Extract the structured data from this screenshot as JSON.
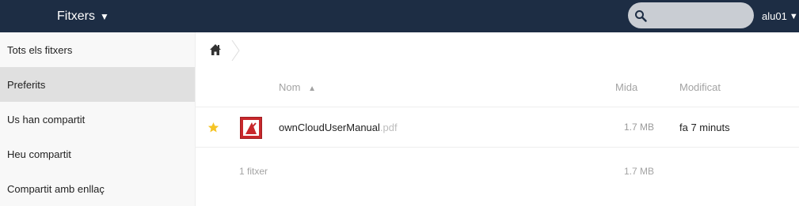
{
  "header": {
    "app_name": "Fitxers",
    "search": {
      "value": "",
      "placeholder": ""
    },
    "user": "alu01"
  },
  "sidebar": {
    "items": [
      {
        "label": "Tots els fitxers",
        "active": false
      },
      {
        "label": "Preferits",
        "active": true
      },
      {
        "label": "Us han compartit",
        "active": false
      },
      {
        "label": "Heu compartit",
        "active": false
      },
      {
        "label": "Compartit amb enllaç",
        "active": false
      }
    ]
  },
  "table": {
    "columns": {
      "name": "Nom",
      "size": "Mida",
      "modified": "Modificat"
    },
    "sort_indicator": "▲",
    "rows": [
      {
        "name": "ownCloudUserManual",
        "ext": ".pdf",
        "size": "1.7 MB",
        "modified": "fa 7 minuts",
        "favorite": true,
        "icon": "pdf-file-icon"
      }
    ],
    "summary": {
      "count": "1 fitxer",
      "size": "1.7 MB"
    }
  },
  "colors": {
    "header_bg": "#1d2d44",
    "sidebar_bg": "#f8f8f8",
    "sidebar_active": "#e0e0e0",
    "favorite_star": "#f5c425",
    "pdf_red": "#c8282c"
  }
}
